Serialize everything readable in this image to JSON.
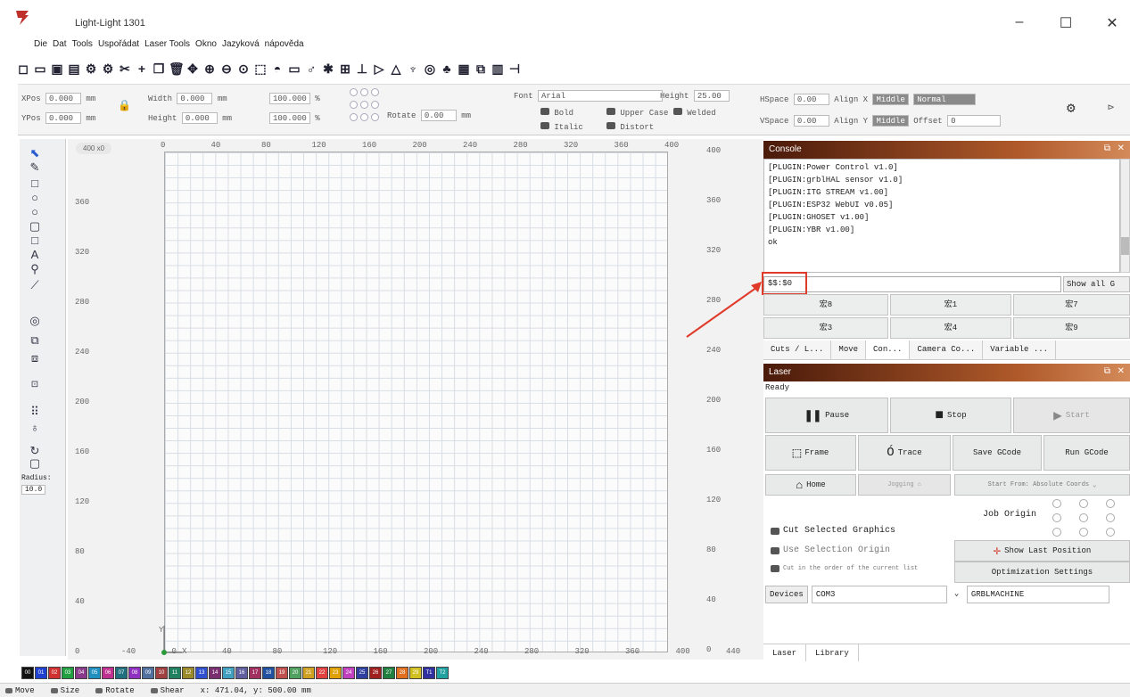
{
  "window": {
    "title": "Light-Light 1301",
    "minimize": "–",
    "maximize": "☐",
    "close": "✕"
  },
  "menu": [
    "Die",
    "Dat",
    "Tools",
    "Uspořádat",
    "Laser Tools",
    "Okno",
    "Jazyková",
    "nápověda"
  ],
  "toolbar_icons": [
    "new-icon",
    "open-icon",
    "save-icon",
    "export-icon",
    "settings-icon",
    "undo-icon",
    "cut-icon",
    "copy-icon",
    "paste-icon",
    "delete-icon",
    "move-icon",
    "zoom-in-icon",
    "zoom-out-icon",
    "zoom-fit-icon",
    "frame-icon",
    "camera-icon",
    "device-icon",
    "tool-icon",
    "star-icon",
    "group-icon",
    "ungroup-icon",
    "align-icon",
    "mirror-icon",
    "rotate-icon",
    "node-icon",
    "offset-icon",
    "array-icon",
    "weld-icon",
    "boolean-icon",
    "grid-icon"
  ],
  "props": {
    "xpos_label": "XPos",
    "xpos_value": "0.000",
    "ypos_label": "YPos",
    "ypos_value": "0.000",
    "unit": "mm",
    "width_label": "Width",
    "width_value": "0.000",
    "height_label": "Height",
    "height_value": "0.000",
    "scale_x": "100.000",
    "scale_y": "100.000",
    "percent": "%",
    "rotate_label": "Rotate",
    "rotate_value": "0.00",
    "font_label": "Font",
    "font_value": "Arial",
    "height_font_label": "Height",
    "height_font_value": "25.00",
    "bold": "Bold",
    "italic": "Italic",
    "upper_case": "Upper Case",
    "distort": "Distort",
    "welded": "Welded",
    "hspace_label": "HSpace",
    "hspace_value": "0.00",
    "vspace_label": "VSpace",
    "vspace_value": "0.00",
    "align_x_label": "Align X",
    "align_x_value": "Middle",
    "align_y_label": "Align Y",
    "align_y_value": "Middle",
    "normal": "Normal",
    "offset_label": "Offset",
    "offset_value": "0"
  },
  "left_tools": {
    "radius_label": "Radius:",
    "radius_value": "10.0"
  },
  "canvas": {
    "cursor_badge": "400 x0",
    "x_ticks": [
      "0",
      "40",
      "80",
      "120",
      "160",
      "200",
      "240",
      "280",
      "320",
      "360",
      "400"
    ],
    "left_ticks": [
      "360",
      "320",
      "280",
      "240",
      "200",
      "160",
      "120",
      "80",
      "40",
      "0"
    ],
    "right_ticks": [
      "400",
      "360",
      "320",
      "280",
      "240",
      "200",
      "160",
      "120",
      "80",
      "40",
      "0"
    ],
    "bottom_ticks": [
      "-40",
      "0",
      "40",
      "80",
      "120",
      "160",
      "200",
      "240",
      "280",
      "320",
      "360",
      "400",
      "440"
    ],
    "y_axis_letter": "Y",
    "x_axis_letter": "X"
  },
  "console": {
    "title": "Console",
    "lines": [
      "[PLUGIN:Power Control v1.0]",
      "[PLUGIN:grblHAL sensor v1.0]",
      "[PLUGIN:ITG STREAM v1.00]",
      "[PLUGIN:ESP32 WebUI v0.05]",
      "[PLUGIN:GHOSET v1.00]",
      "[PLUGIN:YBR v1.00]",
      "ok"
    ],
    "input_value": "$$:$0",
    "show_all": "Show all G",
    "macros": [
      "宏8",
      "宏1",
      "宏7",
      "宏3",
      "宏4",
      "宏9"
    ],
    "tabs": [
      "Cuts / L...",
      "Move",
      "Con...",
      "Camera Co...",
      "Variable ..."
    ]
  },
  "laser": {
    "title": "Laser",
    "status": "Ready",
    "pause": "Pause",
    "stop": "Stop",
    "start": "Start",
    "frame": "Frame",
    "trace": "Trace",
    "save_gcode": "Save GCode",
    "run_gcode": "Run GCode",
    "home": "Home",
    "jog_hint": "Jogging",
    "start_from": "Start From: Absolute Coords",
    "job_origin": "Job Origin",
    "cut_selected": "Cut Selected Graphics",
    "use_selection_origin": "Use Selection Origin",
    "small_option": "Cut in the order of the current list",
    "show_last_position": "Show Last Position",
    "optimization_settings": "Optimization Settings",
    "devices_label": "Devices",
    "device_value": "COM3",
    "port_value": "GRBLMACHINE",
    "bottom_tabs": [
      "Laser",
      "Library"
    ]
  },
  "palette": [
    {
      "color": "#111111",
      "label": "00"
    },
    {
      "color": "#2040d0",
      "label": "01"
    },
    {
      "color": "#d03030",
      "label": "02"
    },
    {
      "color": "#20a040",
      "label": "03"
    },
    {
      "color": "#8a3a8a",
      "label": "04"
    },
    {
      "color": "#2090c0",
      "label": "05"
    },
    {
      "color": "#c03090",
      "label": "06"
    },
    {
      "color": "#207080",
      "label": "07"
    },
    {
      "color": "#9030c0",
      "label": "08"
    },
    {
      "color": "#5070a0",
      "label": "09"
    },
    {
      "color": "#a04040",
      "label": "10"
    },
    {
      "color": "#208060",
      "label": "11"
    },
    {
      "color": "#9a8a2a",
      "label": "12"
    },
    {
      "color": "#3050d0",
      "label": "13"
    },
    {
      "color": "#7a3070",
      "label": "14"
    },
    {
      "color": "#40a0c0",
      "label": "15"
    },
    {
      "color": "#6060a0",
      "label": "16"
    },
    {
      "color": "#a03060",
      "label": "17"
    },
    {
      "color": "#2050a0",
      "label": "18"
    },
    {
      "color": "#c05050",
      "label": "19"
    },
    {
      "color": "#50a060",
      "label": "20"
    },
    {
      "color": "#d0a020",
      "label": "21"
    },
    {
      "color": "#e04040",
      "label": "22"
    },
    {
      "color": "#e0a000",
      "label": "23"
    },
    {
      "color": "#c040c0",
      "label": "24"
    },
    {
      "color": "#3040a0",
      "label": "25"
    },
    {
      "color": "#a02020",
      "label": "26"
    },
    {
      "color": "#208040",
      "label": "27"
    },
    {
      "color": "#e07020",
      "label": "28"
    },
    {
      "color": "#d0c020",
      "label": "29"
    },
    {
      "color": "#3030a0",
      "label": "T1"
    },
    {
      "color": "#20a0a0",
      "label": "T2"
    }
  ],
  "status": {
    "move": "Move",
    "size": "Size",
    "rotate": "Rotate",
    "shear": "Shear",
    "coords": "x: 471.04, y: 500.00 mm"
  }
}
